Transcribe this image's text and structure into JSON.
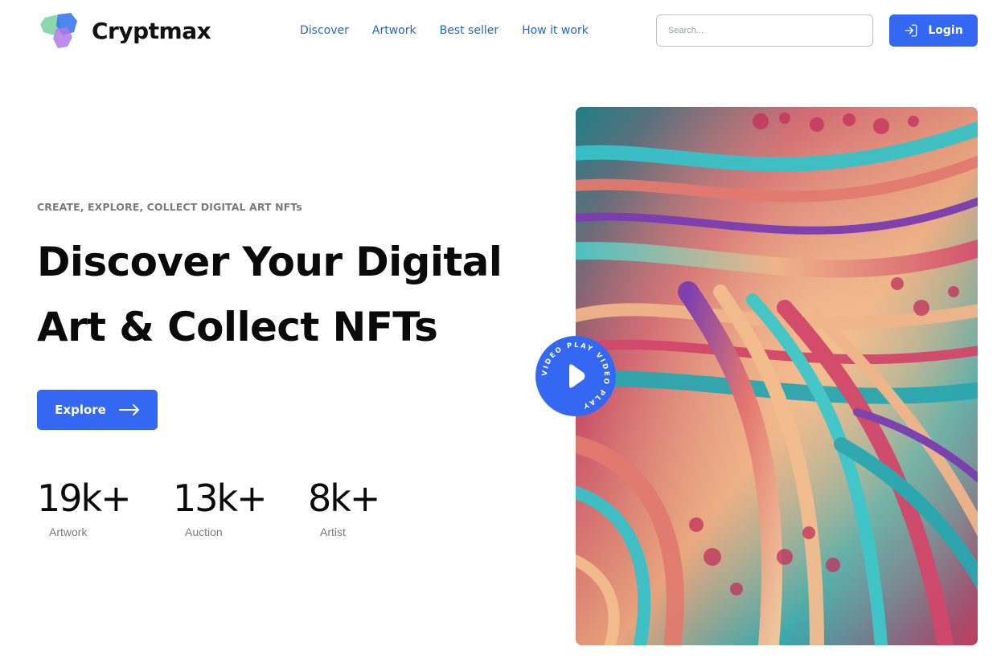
{
  "brand": {
    "name": "Cryptmax"
  },
  "nav": {
    "items": [
      {
        "label": "Discover"
      },
      {
        "label": "Artwork"
      },
      {
        "label": "Best seller"
      },
      {
        "label": "How it work"
      }
    ]
  },
  "search": {
    "placeholder": "Search..."
  },
  "login": {
    "label": "Login",
    "icon": "login-icon"
  },
  "hero": {
    "eyebrow": "CREATE, EXPLORE, COLLECT DIGITAL ART NFTs",
    "title_line1": "Discover Your Digital",
    "title_line2": "Art & Collect NFTs",
    "cta_label": "Explore",
    "cta_icon": "arrow-right-icon"
  },
  "stats": [
    {
      "value": "19k+",
      "label": "Artwork"
    },
    {
      "value": "13k+",
      "label": "Auction"
    },
    {
      "value": "8k+",
      "label": "Artist"
    }
  ],
  "video": {
    "ring_text": "VIDEO PLAY VIDEO PLAY ",
    "icon": "play-icon"
  },
  "colors": {
    "accent": "#3468f2",
    "nav_link": "#2466c8"
  }
}
